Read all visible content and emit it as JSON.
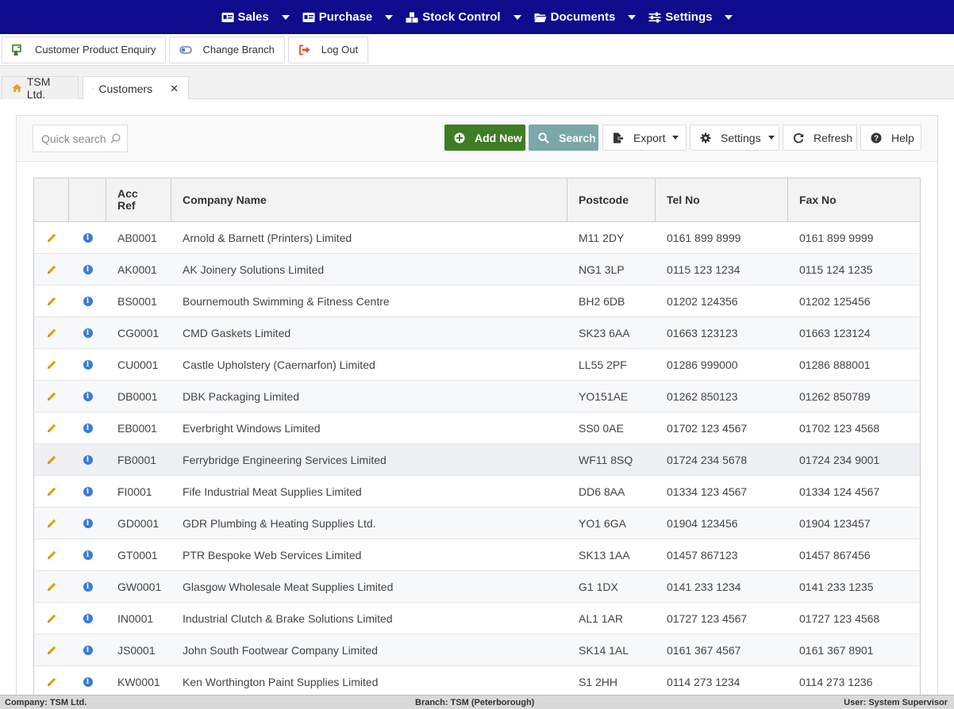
{
  "nav": {
    "items": [
      {
        "label": "Sales",
        "icon": "id-card-icon"
      },
      {
        "label": "Purchase",
        "icon": "id-card-icon"
      },
      {
        "label": "Stock Control",
        "icon": "boxes-icon"
      },
      {
        "label": "Documents",
        "icon": "folder-open-icon"
      },
      {
        "label": "Settings",
        "icon": "sliders-icon"
      }
    ]
  },
  "toolbar": {
    "customer_enquiry": "Customer Product Enquiry",
    "change_branch": "Change Branch",
    "log_out": "Log Out"
  },
  "tabs": {
    "home": "TSM Ltd.",
    "customers": "Customers",
    "close": "✕"
  },
  "panel": {
    "quick_search_placeholder": "Quick search",
    "add_new": "Add New",
    "search": "Search",
    "export": "Export",
    "settings": "Settings",
    "refresh": "Refresh",
    "help": "Help"
  },
  "grid": {
    "headers": {
      "acc_ref": "Acc Ref",
      "company": "Company Name",
      "postcode": "Postcode",
      "tel": "Tel No",
      "fax": "Fax No"
    },
    "rows": [
      [
        "AB0001",
        "Arnold & Barnett (Printers) Limited",
        "M11 2DY",
        "0161 899 8999",
        "0161 899 9999"
      ],
      [
        "AK0001",
        "AK Joinery Solutions Limited",
        "NG1 3LP",
        "0115 123 1234",
        "0115 124 1235"
      ],
      [
        "BS0001",
        "Bournemouth Swimming & Fitness Centre",
        "BH2 6DB",
        "01202 124356",
        "01202 125456"
      ],
      [
        "CG0001",
        "CMD Gaskets Limited",
        "SK23 6AA",
        "01663 123123",
        "01663 123124"
      ],
      [
        "CU0001",
        "Castle Upholstery (Caernarfon) Limited",
        "LL55 2PF",
        "01286 999000",
        "01286 888001"
      ],
      [
        "DB0001",
        "DBK Packaging Limited",
        "YO151AE",
        "01262 850123",
        "01262 850789"
      ],
      [
        "EB0001",
        "Everbright Windows Limited",
        "SS0 0AE",
        "01702 123 4567",
        "01702 123 4568"
      ],
      [
        "FB0001",
        "Ferrybridge Engineering Services Limited",
        "WF11 8SQ",
        "01724 234 5678",
        "01724 234 9001"
      ],
      [
        "FI0001",
        "Fife Industrial Meat Supplies Limited",
        "DD6 8AA",
        "01334 123 4567",
        "01334 124 4567"
      ],
      [
        "GD0001",
        "GDR Plumbing & Heating Supplies Ltd.",
        "YO1 6GA",
        "01904 123456",
        "01904 123457"
      ],
      [
        "GT0001",
        "PTR Bespoke Web Services Limited",
        "SK13 1AA",
        "01457 867123",
        "01457 867456"
      ],
      [
        "GW0001",
        "Glasgow Wholesale Meat Supplies Limited",
        "G1 1DX",
        "0141 233 1234",
        "0141 233 1235"
      ],
      [
        "IN0001",
        "Industrial Clutch & Brake Solutions Limited",
        "AL1 1AR",
        "01727 123 4567",
        "01727 123 4568"
      ],
      [
        "JS0001",
        "John South Footwear Company Limited",
        "SK14 1AL",
        "0161 367 4567",
        "0161 367 8901"
      ],
      [
        "KW0001",
        "Ken Worthington Paint Supplies Limited",
        "S1 2HH",
        "0114 273 1234",
        "0114 273 1236"
      ]
    ]
  },
  "status": {
    "company": "Company: TSM Ltd.",
    "branch": "Branch: TSM (Peterborough)",
    "user": "User: System Supervisor"
  },
  "colors": {
    "nav_bg": "#0e0b8c",
    "add_new": "#3e7d25",
    "search": "#7aa8a8",
    "edit_icon": "#e0a010",
    "info_icon": "#3a7bd5"
  }
}
